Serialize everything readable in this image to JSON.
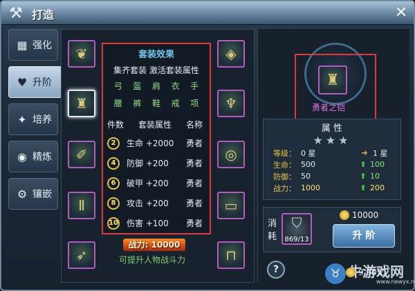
{
  "window": {
    "title": "打造",
    "close_icon": "close-icon"
  },
  "nav": {
    "items": [
      {
        "label": "强化",
        "icon": "anvil-icon",
        "active": false
      },
      {
        "label": "升阶",
        "icon": "heart-icon",
        "active": true
      },
      {
        "label": "培养",
        "icon": "sparkle-icon",
        "active": false
      },
      {
        "label": "精炼",
        "icon": "orb-icon",
        "active": false
      },
      {
        "label": "镶嵌",
        "icon": "gear-gem-icon",
        "active": false
      }
    ]
  },
  "suit": {
    "title": "套装效果",
    "subtitle": "集齐套装 激活套装属性",
    "pieces": [
      "弓",
      "盔",
      "肩",
      "衣",
      "手",
      "腰",
      "裤",
      "鞋",
      "戒",
      "项"
    ],
    "headers": {
      "count": "件数",
      "attr": "套装属性",
      "name": "名称"
    },
    "effects": [
      {
        "count": "2",
        "attr": "生命 +2000",
        "name": "勇者"
      },
      {
        "count": "4",
        "attr": "防御 +200",
        "name": "勇者"
      },
      {
        "count": "6",
        "attr": "破甲 +200",
        "name": "勇者"
      },
      {
        "count": "8",
        "attr": "攻击 +200",
        "name": "勇者"
      },
      {
        "count": "10",
        "attr": "伤害 +100",
        "name": "勇者"
      }
    ],
    "power": "战力: 10000",
    "hint": "可提升人物战斗力"
  },
  "right": {
    "item_name": "勇者之铠",
    "attr_title": "属 性",
    "stars": "★★★",
    "level": {
      "label": "等级：",
      "current": "0 星",
      "next": "1 星"
    },
    "stats": [
      {
        "label": "生命：",
        "current": "500",
        "next": "100"
      },
      {
        "label": "防御：",
        "current": "50",
        "next": "10"
      },
      {
        "label": "战力：",
        "current": "1000",
        "next": "200"
      }
    ],
    "consume_label": "消耗",
    "consume_count": "869/13",
    "gold_cost": "10000",
    "upgrade_label": "升 阶",
    "help": "?",
    "player_gold": "9.90亿"
  },
  "watermark": {
    "text": "牛游戏网",
    "url": "www.newyx.net"
  },
  "colors": {
    "purple_border": "#b25cc4",
    "highlight_red": "#e03a3a",
    "green": "#7ef07a",
    "gold": "#e6c24a"
  }
}
